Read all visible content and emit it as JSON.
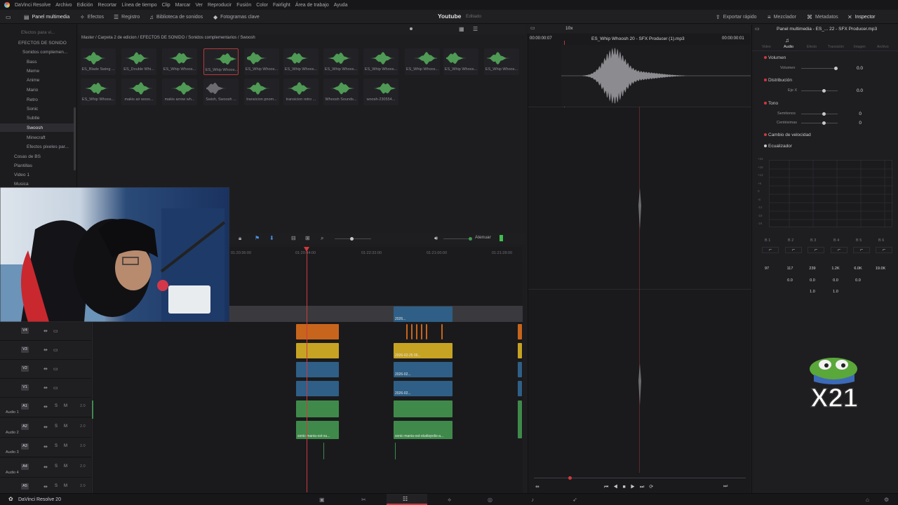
{
  "menu": [
    "DaVinci Resolve",
    "Archivo",
    "Edición",
    "Recortar",
    "Línea de tiempo",
    "Clip",
    "Marcar",
    "Ver",
    "Reproducir",
    "Fusión",
    "Color",
    "Fairlight",
    "Área de trabajo",
    "Ayuda"
  ],
  "pagebar": {
    "panel_multimedia": "Panel multimedia",
    "efectos": "Efectos",
    "registro": "Registro",
    "biblioteca": "Biblioteca de sonidos",
    "fotogramas": "Fotogramas clave",
    "project_title": "Youtube",
    "project_status": "Editado",
    "exportar": "Exportar rápido",
    "mezclador": "Mezclador",
    "metadatos": "Metadatos",
    "inspector": "Inspector"
  },
  "sidebar": {
    "items": [
      "Efectos para vi...",
      "EFECTOS DE SONIDO",
      "Sonidos complemen...",
      "Bass",
      "Meme",
      "Anime",
      "Mario",
      "Retro",
      "Sonic",
      "Subtle",
      "Swoosh",
      "Minecraft",
      "Efectos pixeles par...",
      "Cosas de BS",
      "Plantillas",
      "Video 1",
      "Musica"
    ],
    "selected": "Swoosh"
  },
  "breadcrumb": "Master / Carpeta 2 de edicion / EFECTOS DE SONIDO / Sonidos complementarios / Swoosh",
  "clips_row1": [
    "ES_Blade Swing ...",
    "ES_Double Whi...",
    "ES_Whip Whoos...",
    "ES_Whip Whoos...",
    "ES_Whip Whoos...",
    "ES_Whip Whoos...",
    "ES_Whip Whoos...",
    "ES_Whip Whoos...",
    "ES_Whip Whoos...",
    "ES_Whip Whoos...",
    "ES_Whip Whoos..."
  ],
  "clips_row2": [
    "ES_Whip Whoos...",
    "makis air woos...",
    "makis arrow wh...",
    "Swish, Swoosh ...",
    "transicion pnom...",
    "transicion retro ...",
    "Whoosh Sounds...",
    "woosh-230554..."
  ],
  "selected_clip_index": 3,
  "timeline": {
    "ruler": [
      "01:20:36:00",
      "01:20:44:00",
      "01:22:32:00",
      "01:21:00:00",
      "01:21:28:00"
    ],
    "mode": "Atenuar",
    "video_tracks": [
      "V4",
      "V3",
      "V2",
      "V1"
    ],
    "audio_tracks": [
      {
        "id": "A1",
        "name": "Audio 1",
        "level": "2.0"
      },
      {
        "id": "A2",
        "name": "Audio 2",
        "level": "2.0"
      },
      {
        "id": "A3",
        "name": "Audio 3",
        "level": "2.0"
      },
      {
        "id": "A4",
        "name": "Audio 4",
        "level": "2.0"
      },
      {
        "id": "A5",
        "name": "",
        "level": "2.0"
      }
    ],
    "clip_labels": {
      "v_date1": "2026-02-25 06...",
      "v_date2": "2026-02...",
      "v_small": "2026...",
      "a_music1": "sonic-mania-ost-su...",
      "a_music2": "sonic-mania-ost-studiopolis-a..."
    }
  },
  "viewer": {
    "zoom": "10x",
    "timecode_left": "00:00:00:07",
    "clip_name": "ES_Whip Whoosh 20 - SFX Producer (1).mp3",
    "timecode_right": "00:00:00:01"
  },
  "inspector": {
    "header": "Panel multimedia - ES_... 22 - SFX Producer.mp3",
    "tabs": [
      "Video",
      "Audio",
      "Efecto",
      "Transición",
      "Imagen",
      "Archivo"
    ],
    "volumen": {
      "title": "Volumen",
      "label": "Volumen",
      "value": "0.0"
    },
    "distribucion": {
      "title": "Distribución",
      "label": "Eje X",
      "value": "0.0"
    },
    "tono": {
      "title": "Tono",
      "semitonos_label": "Semitonos",
      "semitonos": "0",
      "centesimas_label": "Centésimas",
      "centesimas": "0"
    },
    "cambio_velocidad": "Cambio de velocidad",
    "ecualizador": "Ecualizador",
    "eq_bands": [
      "B 1",
      "B 2",
      "B 3",
      "B 4",
      "B 5",
      "B 6"
    ],
    "eq_freq": [
      "97",
      "117",
      "239",
      "1.2K",
      "6.0K",
      "19.0K"
    ],
    "eq_gain": [
      "0.0",
      "0.0",
      "0.0",
      "0.0"
    ],
    "eq_q": [
      "1.0",
      "1.0"
    ],
    "eq_db_labels": [
      "+24",
      "+18",
      "+12",
      "+6",
      "0",
      "-6",
      "-12",
      "-18",
      "-24"
    ]
  },
  "bottom": {
    "app_name": "DaVinci Resolve 20"
  },
  "overlay_badge": "X21",
  "colors": {
    "accent_red": "#d0393d",
    "video_blue": "#2f5f86",
    "video_orange": "#c8651c",
    "video_yellow": "#c7a323",
    "audio_green": "#3f8a4a"
  }
}
